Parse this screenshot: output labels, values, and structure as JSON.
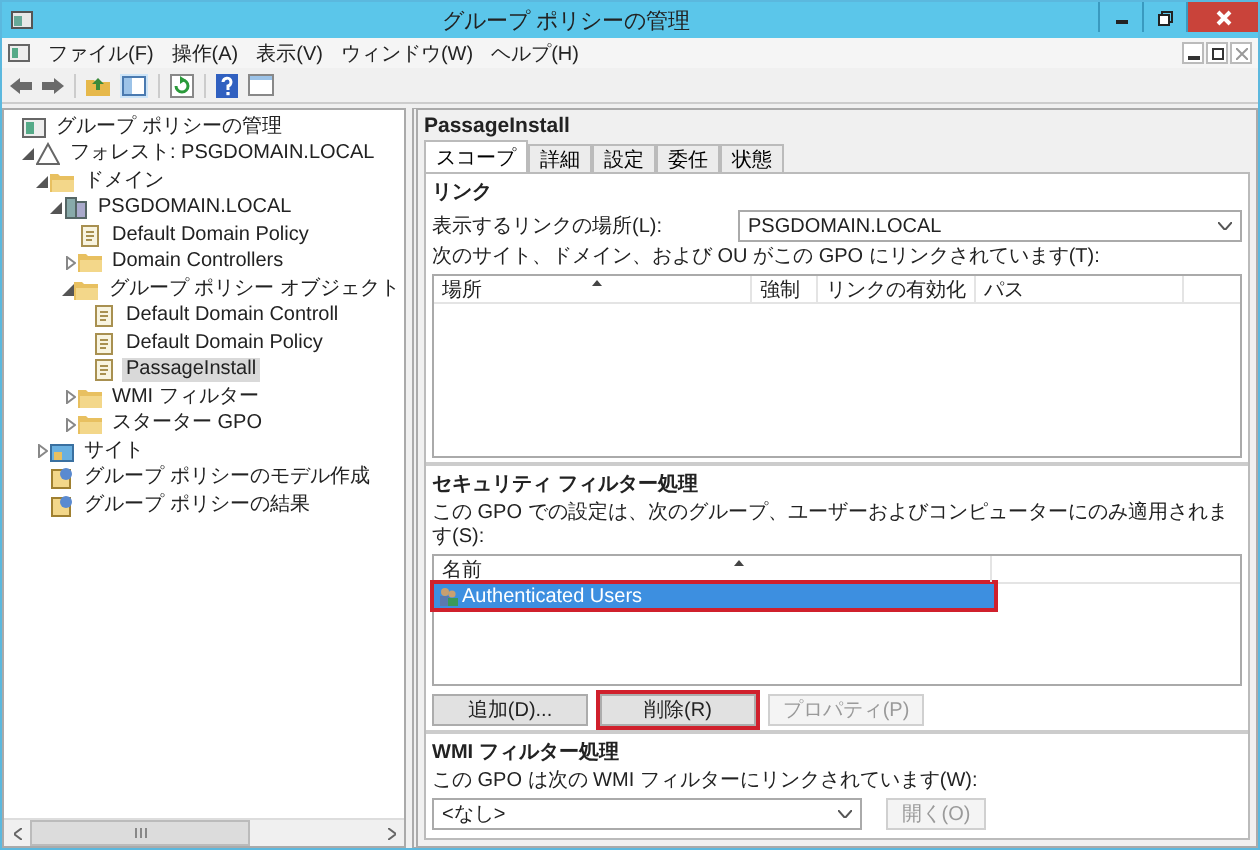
{
  "window": {
    "title": "グループ ポリシーの管理"
  },
  "menu": [
    "ファイル(F)",
    "操作(A)",
    "表示(V)",
    "ウィンドウ(W)",
    "ヘルプ(H)"
  ],
  "tree": [
    {
      "label": "グループ ポリシーの管理",
      "kind": "console",
      "selected": false,
      "children": [
        {
          "label": "フォレスト: PSGDOMAIN.LOCAL",
          "kind": "forest",
          "expanded": true,
          "selected": false,
          "children": [
            {
              "label": "ドメイン",
              "kind": "folder",
              "expanded": true,
              "selected": false,
              "children": [
                {
                  "label": "PSGDOMAIN.LOCAL",
                  "kind": "domain",
                  "expanded": true,
                  "selected": false,
                  "children": [
                    {
                      "label": "Default Domain Policy",
                      "kind": "gpo",
                      "selected": false
                    },
                    {
                      "label": "Domain Controllers",
                      "kind": "folder",
                      "expanded": false,
                      "selected": false
                    },
                    {
                      "label": "グループ ポリシー オブジェクト",
                      "kind": "folder",
                      "expanded": true,
                      "selected": false,
                      "children": [
                        {
                          "label": "Default Domain Controll",
                          "kind": "gpo",
                          "selected": false
                        },
                        {
                          "label": "Default Domain Policy",
                          "kind": "gpo",
                          "selected": false
                        },
                        {
                          "label": "PassageInstall",
                          "kind": "gpo",
                          "selected": true
                        }
                      ]
                    },
                    {
                      "label": "WMI フィルター",
                      "kind": "folder",
                      "expanded": false,
                      "selected": false
                    },
                    {
                      "label": "スターター GPO",
                      "kind": "folder",
                      "expanded": false,
                      "selected": false
                    }
                  ]
                }
              ]
            },
            {
              "label": "サイト",
              "kind": "sites",
              "expanded": false,
              "selected": false
            },
            {
              "label": "グループ ポリシーのモデル作成",
              "kind": "report",
              "selected": false
            },
            {
              "label": "グループ ポリシーの結果",
              "kind": "report",
              "selected": false
            }
          ]
        }
      ]
    }
  ],
  "details": {
    "title": "PassageInstall",
    "tabs": [
      {
        "label": "スコープ",
        "selected": true
      },
      {
        "label": "詳細",
        "selected": false
      },
      {
        "label": "設定",
        "selected": false
      },
      {
        "label": "委任",
        "selected": false
      },
      {
        "label": "状態",
        "selected": false
      }
    ],
    "links": {
      "heading": "リンク",
      "location_label": "表示するリンクの場所(L):",
      "location_value": "PSGDOMAIN.LOCAL",
      "list_label": "次のサイト、ドメイン、および OU がこの GPO にリンクされています(T):",
      "columns": [
        "場所",
        "強制",
        "リンクの有効化",
        "パス"
      ]
    },
    "security": {
      "heading": "セキュリティ フィルター処理",
      "description": "この GPO での設定は、次のグループ、ユーザーおよびコンピューターにのみ適用されます(S):",
      "columns": [
        "名前"
      ],
      "rows": [
        {
          "name": "Authenticated Users",
          "selected": true,
          "highlighted": true
        }
      ],
      "buttons": [
        {
          "label": "追加(D)...",
          "disabled": false,
          "highlighted": false
        },
        {
          "label": "削除(R)",
          "disabled": false,
          "highlighted": true
        },
        {
          "label": "プロパティ(P)",
          "disabled": true,
          "highlighted": false
        }
      ]
    },
    "wmi": {
      "heading": "WMI フィルター処理",
      "description": "この GPO は次の WMI フィルターにリンクされています(W):",
      "value": "<なし>",
      "button": {
        "label": "開く(O)",
        "disabled": true
      }
    }
  }
}
